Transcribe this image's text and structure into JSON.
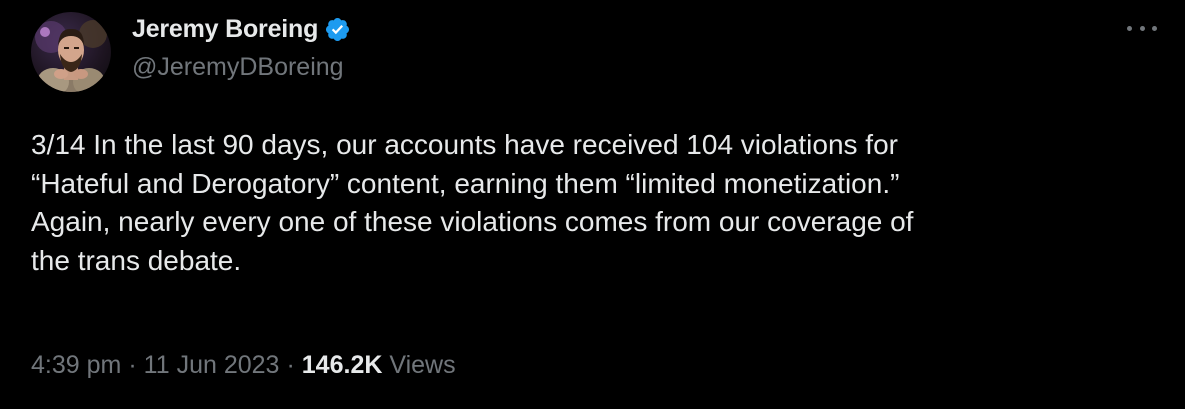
{
  "author": {
    "display_name": "Jeremy Boreing",
    "handle": "@JeremyDBoreing",
    "verified": true
  },
  "tweet": {
    "text": "3/14 In the last 90 days, our accounts have received 104 violations for “Hateful and Derogatory” content, earning them “limited monetization.” Again, nearly every one of these violations comes from our coverage of the trans debate.",
    "lines": [
      "3/14 In the last 90 days, our accounts have received 104 violations for",
      "“Hateful and Derogatory” content, earning them “limited monetization.”",
      "Again, nearly every one of these violations comes from our coverage of",
      "the trans debate."
    ],
    "time": "4:39 pm",
    "date": "11 Jun 2023",
    "separator": "·",
    "views_count": "146.2K",
    "views_label": "Views"
  },
  "icons": {
    "verified": "verified-badge-icon",
    "more": "more-options-icon"
  },
  "colors": {
    "background": "#000000",
    "primary_text": "#e7e9ea",
    "secondary_text": "#71767b",
    "verified_blue": "#1d9bf0"
  }
}
